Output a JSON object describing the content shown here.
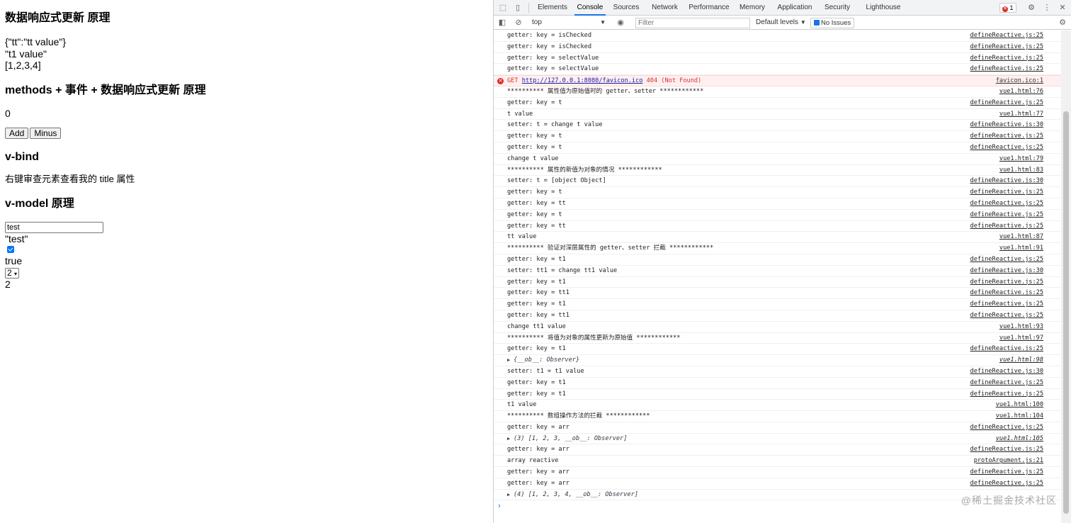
{
  "page": {
    "h1": "数据响应式更新 原理",
    "obj_json": "{\"tt\":\"tt value\"}",
    "t1_text": "\"t1 value\"",
    "arr_text": "[1,2,3,4]",
    "h2": "methods + 事件 + 数据响应式更新 原理",
    "counter": "0",
    "add_label": "Add",
    "minus_label": "Minus",
    "h3": "v-bind",
    "bind_text": "右键审查元素查看我的 title 属性",
    "h4": "v-model 原理",
    "input_value": "test",
    "input_echo": "\"test\"",
    "checkbox_echo": "true",
    "select_value": "2",
    "select_echo": "2"
  },
  "devtools": {
    "tabs": [
      "Elements",
      "Console",
      "Sources",
      "Network",
      "Performance",
      "Memory",
      "Application",
      "Security",
      "Lighthouse"
    ],
    "active_tab": "Console",
    "error_count": "1",
    "context": "top",
    "filter_placeholder": "Filter",
    "levels": "Default levels",
    "issues": "No Issues",
    "rows": [
      {
        "text": "getter: key = isChecked",
        "src": "defineReactive.js:25"
      },
      {
        "text": "getter: key = isChecked",
        "src": "defineReactive.js:25"
      },
      {
        "text": "getter: key = selectValue",
        "src": "defineReactive.js:25"
      },
      {
        "text": "getter: key = selectValue",
        "src": "defineReactive.js:25"
      },
      {
        "type": "error",
        "prefix": "GET ",
        "link": "http://127.0.0.1:8080/favicon.ico",
        "suffix": " 404 (Not Found)",
        "src": "favicon.ico:1"
      },
      {
        "text": "********** 属性值为原始值时的 getter、setter ************",
        "src": "vue1.html:76"
      },
      {
        "text": "getter: key = t",
        "src": "defineReactive.js:25"
      },
      {
        "text": "t value",
        "src": "vue1.html:77"
      },
      {
        "text": "setter: t = change t value",
        "src": "defineReactive.js:30"
      },
      {
        "text": "getter: key = t",
        "src": "defineReactive.js:25"
      },
      {
        "text": "getter: key = t",
        "src": "defineReactive.js:25"
      },
      {
        "text": "change t value",
        "src": "vue1.html:79"
      },
      {
        "text": "********** 属性的新值为对象的情况 ************",
        "src": "vue1.html:83"
      },
      {
        "text": "setter: t = [object Object]",
        "src": "defineReactive.js:30"
      },
      {
        "text": "getter: key = t",
        "src": "defineReactive.js:25"
      },
      {
        "text": "getter: key = tt",
        "src": "defineReactive.js:25"
      },
      {
        "text": "getter: key = t",
        "src": "defineReactive.js:25"
      },
      {
        "text": "getter: key = tt",
        "src": "defineReactive.js:25"
      },
      {
        "text": "tt value",
        "src": "vue1.html:87"
      },
      {
        "text": "********** 验证对深层属性的 getter、setter 拦截 ************",
        "src": "vue1.html:91"
      },
      {
        "text": "getter: key = t1",
        "src": "defineReactive.js:25"
      },
      {
        "text": "setter: tt1 = change tt1 value",
        "src": "defineReactive.js:30"
      },
      {
        "text": "getter: key = t1",
        "src": "defineReactive.js:25"
      },
      {
        "text": "getter: key = tt1",
        "src": "defineReactive.js:25"
      },
      {
        "text": "getter: key = t1",
        "src": "defineReactive.js:25"
      },
      {
        "text": "getter: key = tt1",
        "src": "defineReactive.js:25"
      },
      {
        "text": "change tt1 value",
        "src": "vue1.html:93"
      },
      {
        "text": "********** 将值为对象的属性更新为原始值 ************",
        "src": "vue1.html:97"
      },
      {
        "text": "getter: key = t1",
        "src": "defineReactive.js:25"
      },
      {
        "type": "object",
        "text": "{__ob__: Observer}",
        "src": "vue1.html:98"
      },
      {
        "text": "setter: t1 = t1 value",
        "src": "defineReactive.js:30"
      },
      {
        "text": "getter: key = t1",
        "src": "defineReactive.js:25"
      },
      {
        "text": "getter: key = t1",
        "src": "defineReactive.js:25"
      },
      {
        "text": "t1 value",
        "src": "vue1.html:100"
      },
      {
        "text": "********** 数组操作方法的拦截 ************",
        "src": "vue1.html:104"
      },
      {
        "text": "getter: key = arr",
        "src": "defineReactive.js:25"
      },
      {
        "type": "object",
        "text": "(3) [1, 2, 3, __ob__: Observer]",
        "src": "vue1.html:105"
      },
      {
        "text": "getter: key = arr",
        "src": "defineReactive.js:25"
      },
      {
        "text": "array reactive",
        "src": "protoArgument.js:21"
      },
      {
        "text": "getter: key = arr",
        "src": "defineReactive.js:25"
      },
      {
        "text": "getter: key = arr",
        "src": "defineReactive.js:25"
      },
      {
        "type": "object",
        "text": "(4) [1, 2, 3, 4, __ob__: Observer]",
        "src": ""
      }
    ],
    "prompt": "›"
  },
  "watermark": "@稀土掘金技术社区"
}
